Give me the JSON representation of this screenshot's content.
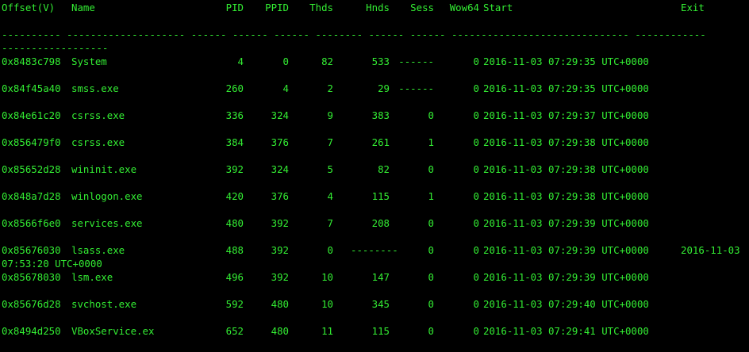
{
  "terminal": {
    "header": {
      "offset": "Offset(V)",
      "name": "Name",
      "pid": "PID",
      "ppid": "PPID",
      "thds": "Thds",
      "hnds": "Hnds",
      "sess": "Sess",
      "wow64": "Wow64",
      "start": "Start",
      "exit": "Exit"
    },
    "separator_line": "---------- -------------------- ------ ------ ------ -------- ------ ------ ------------------------------ ------------",
    "separator_wrap": "------------------",
    "rows": [
      {
        "offset": "0x8483c798",
        "name": "System",
        "pid": "4",
        "ppid": "0",
        "thds": "82",
        "hnds": "533",
        "sess": "------",
        "wow64": "0",
        "start": "2016-11-03 07:29:35 UTC+0000",
        "exit": ""
      },
      {
        "offset": "0x84f45a40",
        "name": "smss.exe",
        "pid": "260",
        "ppid": "4",
        "thds": "2",
        "hnds": "29",
        "sess": "------",
        "wow64": "0",
        "start": "2016-11-03 07:29:35 UTC+0000",
        "exit": ""
      },
      {
        "offset": "0x84e61c20",
        "name": "csrss.exe",
        "pid": "336",
        "ppid": "324",
        "thds": "9",
        "hnds": "383",
        "sess": "0",
        "wow64": "0",
        "start": "2016-11-03 07:29:37 UTC+0000",
        "exit": ""
      },
      {
        "offset": "0x856479f0",
        "name": "csrss.exe",
        "pid": "384",
        "ppid": "376",
        "thds": "7",
        "hnds": "261",
        "sess": "1",
        "wow64": "0",
        "start": "2016-11-03 07:29:38 UTC+0000",
        "exit": ""
      },
      {
        "offset": "0x85652d28",
        "name": "wininit.exe",
        "pid": "392",
        "ppid": "324",
        "thds": "5",
        "hnds": "82",
        "sess": "0",
        "wow64": "0",
        "start": "2016-11-03 07:29:38 UTC+0000",
        "exit": ""
      },
      {
        "offset": "0x848a7d28",
        "name": "winlogon.exe",
        "pid": "420",
        "ppid": "376",
        "thds": "4",
        "hnds": "115",
        "sess": "1",
        "wow64": "0",
        "start": "2016-11-03 07:29:38 UTC+0000",
        "exit": ""
      },
      {
        "offset": "0x8566f6e0",
        "name": "services.exe",
        "pid": "480",
        "ppid": "392",
        "thds": "7",
        "hnds": "208",
        "sess": "0",
        "wow64": "0",
        "start": "2016-11-03 07:29:39 UTC+0000",
        "exit": ""
      },
      {
        "offset": "0x85676030",
        "name": "lsass.exe",
        "pid": "488",
        "ppid": "392",
        "thds": "0",
        "hnds": "--------",
        "sess": "0",
        "wow64": "0",
        "start": "2016-11-03 07:29:39 UTC+0000",
        "exit": "2016-11-03",
        "exit_wrap": "07:53:20 UTC+0000"
      },
      {
        "offset": "0x85678030",
        "name": "lsm.exe",
        "pid": "496",
        "ppid": "392",
        "thds": "10",
        "hnds": "147",
        "sess": "0",
        "wow64": "0",
        "start": "2016-11-03 07:29:39 UTC+0000",
        "exit": ""
      },
      {
        "offset": "0x85676d28",
        "name": "svchost.exe",
        "pid": "592",
        "ppid": "480",
        "thds": "10",
        "hnds": "345",
        "sess": "0",
        "wow64": "0",
        "start": "2016-11-03 07:29:40 UTC+0000",
        "exit": ""
      },
      {
        "offset": "0x8494d250",
        "name": "VBoxService.ex",
        "pid": "652",
        "ppid": "480",
        "thds": "11",
        "hnds": "115",
        "sess": "0",
        "wow64": "0",
        "start": "2016-11-03 07:29:41 UTC+0000",
        "exit": ""
      }
    ]
  }
}
